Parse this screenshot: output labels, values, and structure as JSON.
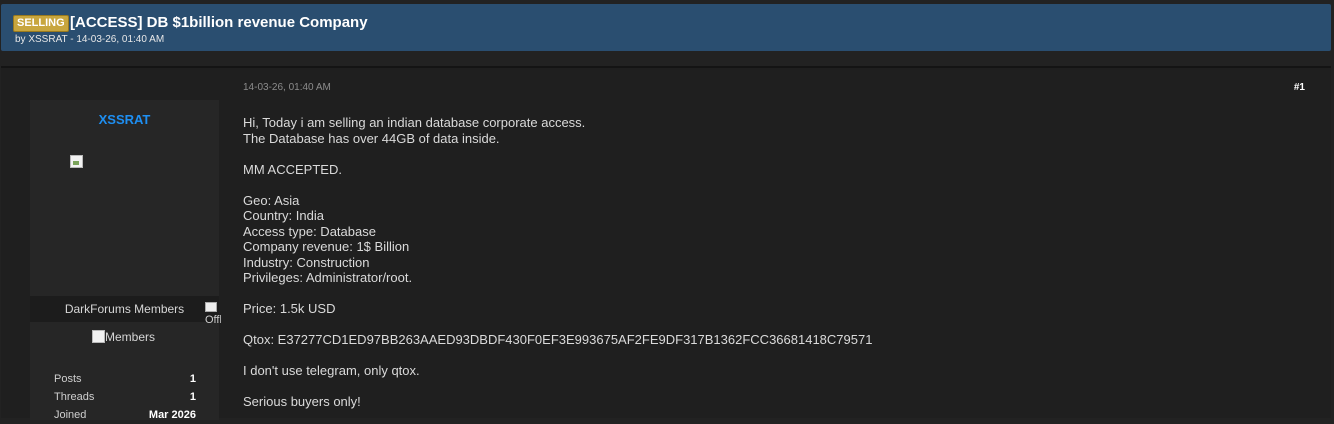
{
  "thread": {
    "prefix": "SELLING",
    "title": "[ACCESS] DB $1billion revenue Company",
    "byline": "by XSSRAT - 14-03-26, 01:40 AM"
  },
  "post": {
    "date": "14-03-26, 01:40 AM",
    "number": "#1",
    "lines": [
      "Hi, Today i am selling an indian database corporate access.",
      "The Database has over 44GB of data inside.",
      "",
      "MM ACCEPTED.",
      "",
      "Geo: Asia",
      "Country: India",
      "Access type: Database",
      "Company revenue: 1$ Billion",
      "Industry: Construction",
      "Privileges: Administrator/root.",
      "",
      "Price: 1.5k USD",
      "",
      "Qtox: E37277CD1ED97BB263AAED93DBDF430F0EF3E993675AF2FE9DF317B1362FCC36681418C79571",
      "",
      "I don't use telegram, only qtox.",
      "",
      "Serious buyers only!"
    ]
  },
  "author": {
    "name": "XSSRAT",
    "usergroup": "DarkForums Members",
    "group_image_alt": "Members",
    "offline_alt": "Offline",
    "stats": [
      {
        "label": "Posts",
        "value": "1"
      },
      {
        "label": "Threads",
        "value": "1"
      },
      {
        "label": "Joined",
        "value": "Mar 2026"
      }
    ]
  },
  "colors": {
    "header_bg": "#2a4e70",
    "prefix_bg": "#c8a63e",
    "username": "#1e8ff2"
  }
}
